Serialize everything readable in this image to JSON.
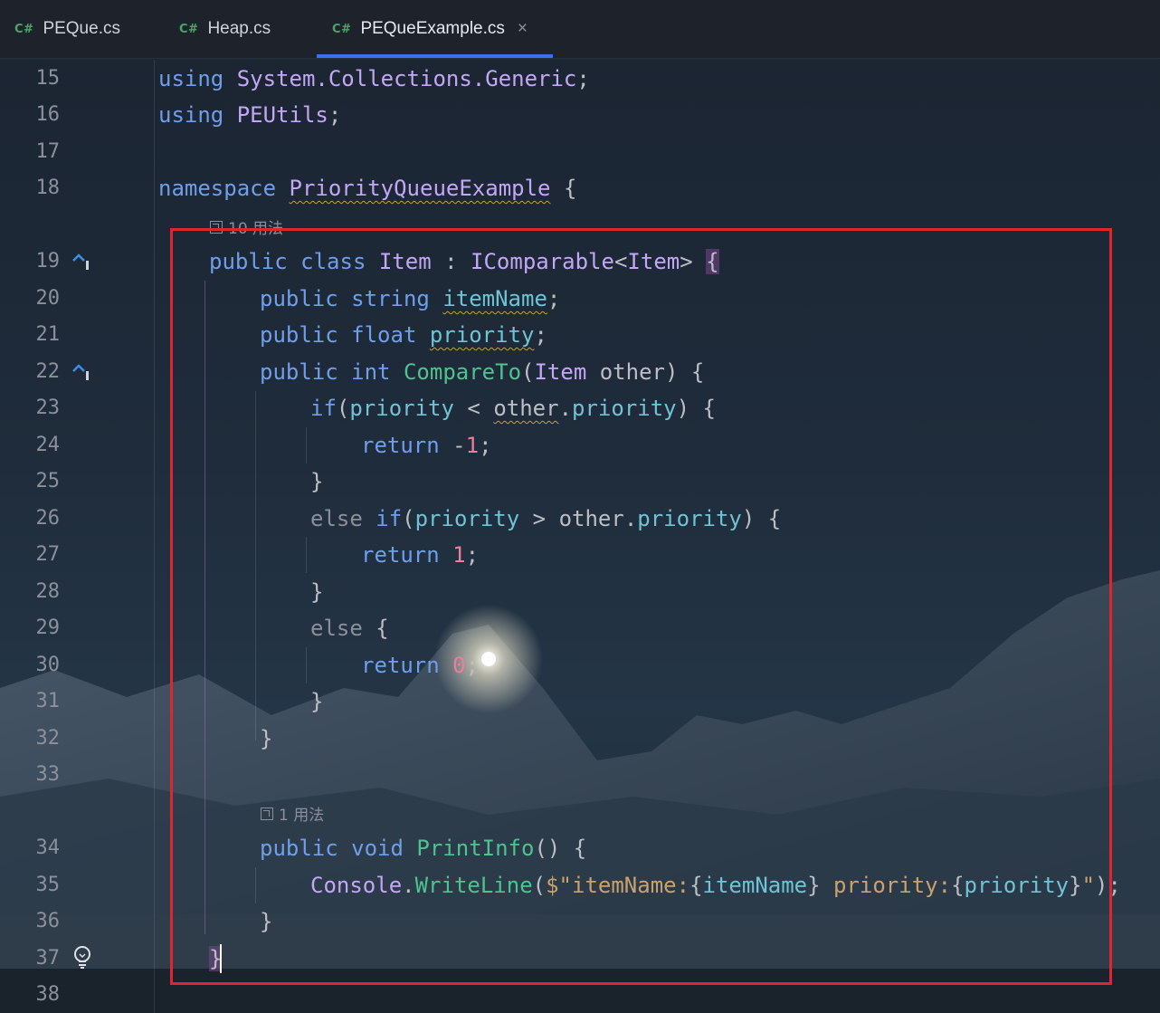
{
  "tabs": [
    {
      "lang": "C#",
      "label": "PEQue.cs"
    },
    {
      "lang": "C#",
      "label": "Heap.cs"
    },
    {
      "lang": "C#",
      "label": "PEQueExample.cs",
      "close": "×"
    }
  ],
  "line_numbers": [
    "15",
    "16",
    "17",
    "18",
    "19",
    "20",
    "21",
    "22",
    "23",
    "24",
    "25",
    "26",
    "27",
    "28",
    "29",
    "30",
    "31",
    "32",
    "33",
    "34",
    "35",
    "36",
    "37",
    "38"
  ],
  "hints": {
    "class_usages": "10 用法",
    "method_usages": "1 用法"
  },
  "code": {
    "l15": [
      "using",
      "System.Collections.Generic",
      ";"
    ],
    "l16": [
      "using",
      "PEUtils",
      ";"
    ],
    "l18": [
      "namespace",
      "PriorityQueueExample",
      "{"
    ],
    "l19": [
      "public",
      "class",
      "Item",
      ":",
      "IComparable",
      "<",
      "Item",
      ">",
      "{"
    ],
    "l20": [
      "public",
      "string",
      "itemName",
      ";"
    ],
    "l21": [
      "public",
      "float",
      "priority",
      ";"
    ],
    "l22": [
      "public",
      "int",
      "CompareTo",
      "(",
      "Item",
      "other",
      ") {"
    ],
    "l23": [
      "if",
      "(",
      "priority",
      "<",
      "other",
      ".",
      "priority",
      ") {"
    ],
    "l24": [
      "return",
      "-",
      "1",
      ";"
    ],
    "l25": "}",
    "l26": [
      "else",
      "if",
      "(",
      "priority",
      ">",
      "other",
      ".",
      "priority",
      ") {"
    ],
    "l27": [
      "return",
      "1",
      ";"
    ],
    "l28": "}",
    "l29": [
      "else",
      "{"
    ],
    "l30": [
      "return",
      "0",
      ";"
    ],
    "l31": "}",
    "l32": "}",
    "l34": [
      "public",
      "void",
      "PrintInfo",
      "() {"
    ],
    "l35": [
      "Console",
      ".",
      "WriteLine",
      "(",
      "$\"itemName:",
      "{",
      "itemName",
      "}",
      " priority:",
      "{",
      "priority",
      "}",
      "\"",
      ");"
    ],
    "l36": "}",
    "l37": "}"
  },
  "colors": {
    "highlight_box": "#e0252f",
    "tab_underline": "#3574f0"
  }
}
